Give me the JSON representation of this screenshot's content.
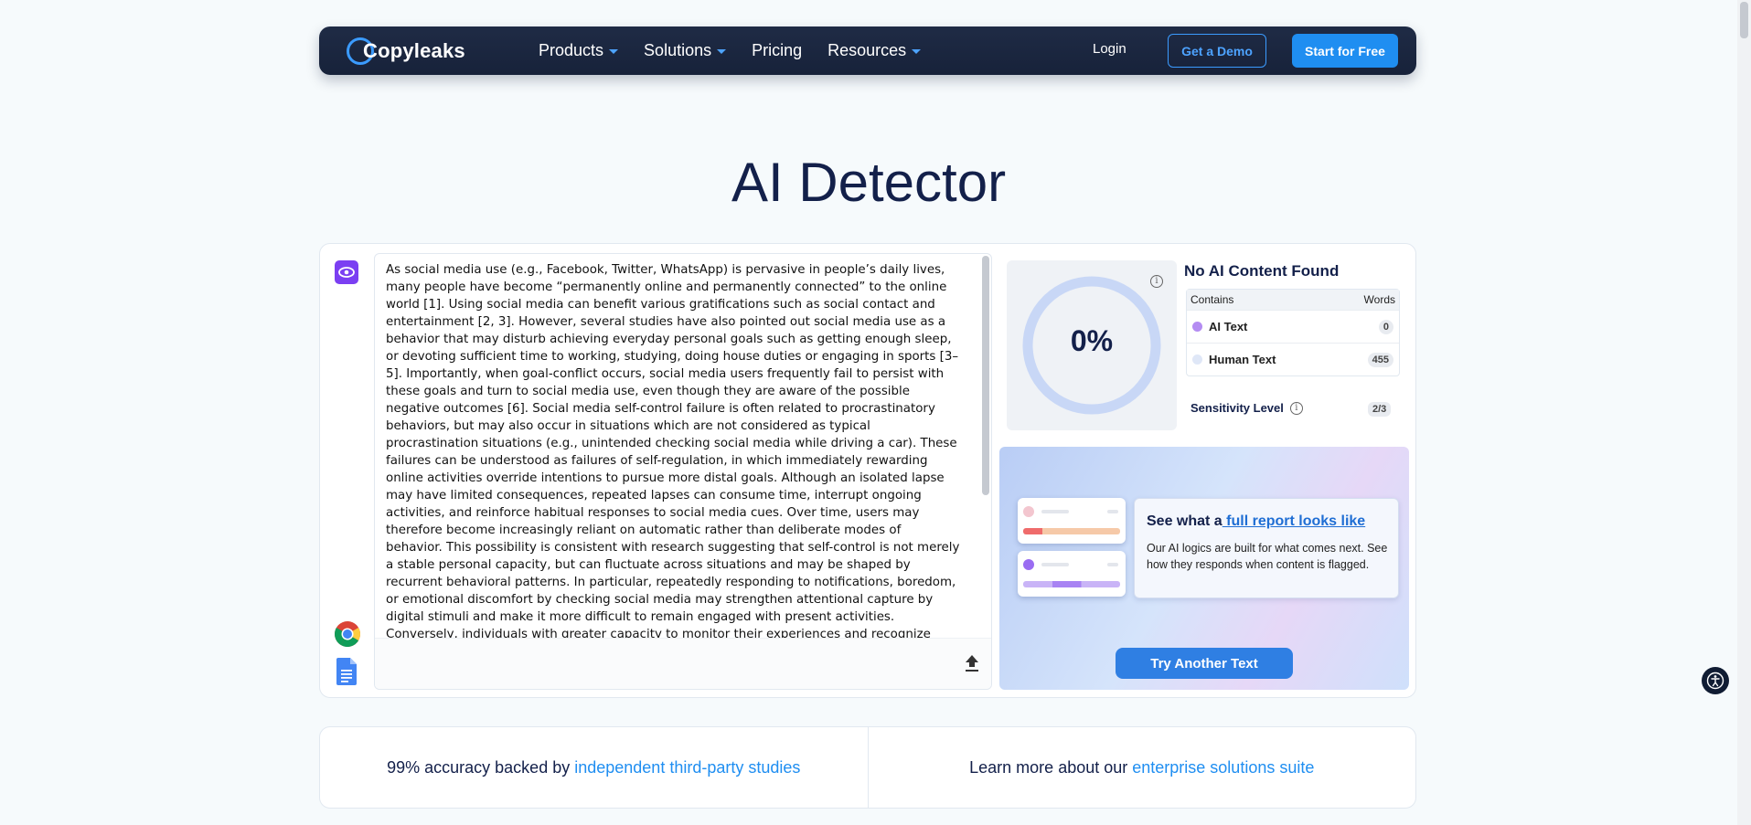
{
  "nav": {
    "logo": "Copyleaks",
    "links": [
      {
        "label": "Products",
        "dropdown": true
      },
      {
        "label": "Solutions",
        "dropdown": true
      },
      {
        "label": "Pricing",
        "dropdown": false
      },
      {
        "label": "Resources",
        "dropdown": true
      }
    ],
    "login": "Login",
    "demo": "Get a Demo",
    "start": "Start for Free"
  },
  "page_title": "AI Detector",
  "input_text": "As social media use (e.g., Facebook, Twitter, WhatsApp) is pervasive in people’s daily lives, many people have become “permanently online and permanently connected” to the online world [1]. Using social media can benefit various gratifications such as social contact and entertainment [2, 3]. However, several studies have also pointed out social media use as a behavior that may disturb achieving everyday personal goals such as getting enough sleep, or devoting sufficient time to working, studying, doing house duties or engaging in sports [3–5]. Importantly, when goal-conflict occurs, social media users frequently fail to persist with these goals and turn to social media use, even though they are aware of the possible negative outcomes [6]. Social media self-control failure is often related to procrastinatory behaviors, but may also occur in situations which are not considered as typical procrastination situations (e.g., unintended checking social media while driving a car). These failures can be understood as failures of self-regulation, in which immediately rewarding online activities override intentions to pursue more distal goals. Although an isolated lapse may have limited consequences, repeated lapses can consume time, interrupt ongoing activities, and reinforce habitual responses to social media cues. Over time, users may therefore become increasingly reliant on automatic rather than deliberate modes of behavior. This possibility is consistent with research suggesting that self-control is not merely a stable personal capacity, but can fluctuate across situations and may be shaped by recurrent behavioral patterns. In particular, repeatedly responding to notifications, boredom, or emotional discomfort by checking social media may strengthen attentional capture by digital stimuli and make it more difficult to remain engaged with present activities. Conversely, individuals with greater capacity to monitor their experiences and recognize emerging impulses may be better able to interrupt such routines. Examining the relation",
  "result": {
    "score": "0%",
    "score_fraction": 0,
    "title": "No AI Content Found",
    "table_header": {
      "contains": "Contains",
      "words": "Words"
    },
    "rows": [
      {
        "label": "AI Text",
        "count": "0",
        "color": "#b48cf2"
      },
      {
        "label": "Human Text",
        "count": "455",
        "color": "#dfe7f7"
      }
    ],
    "sensitivity_label": "Sensitivity Level",
    "sensitivity_value": "2/3"
  },
  "promo": {
    "heading_prefix": "See what a",
    "heading_link": " full report looks like",
    "body": "Our AI logics are built for what comes next. See how they responds when content is flagged.",
    "try_button": "Try Another Text"
  },
  "bottom": {
    "left_text": "99% accuracy backed by",
    "left_link": "independent third-party studies",
    "right_text": "Learn more about our",
    "right_link": "enterprise solutions suite"
  },
  "colors": {
    "nav_bg": "#1f2b45",
    "accent": "#1f8ef1",
    "ai_purple": "#7b3ff2"
  }
}
